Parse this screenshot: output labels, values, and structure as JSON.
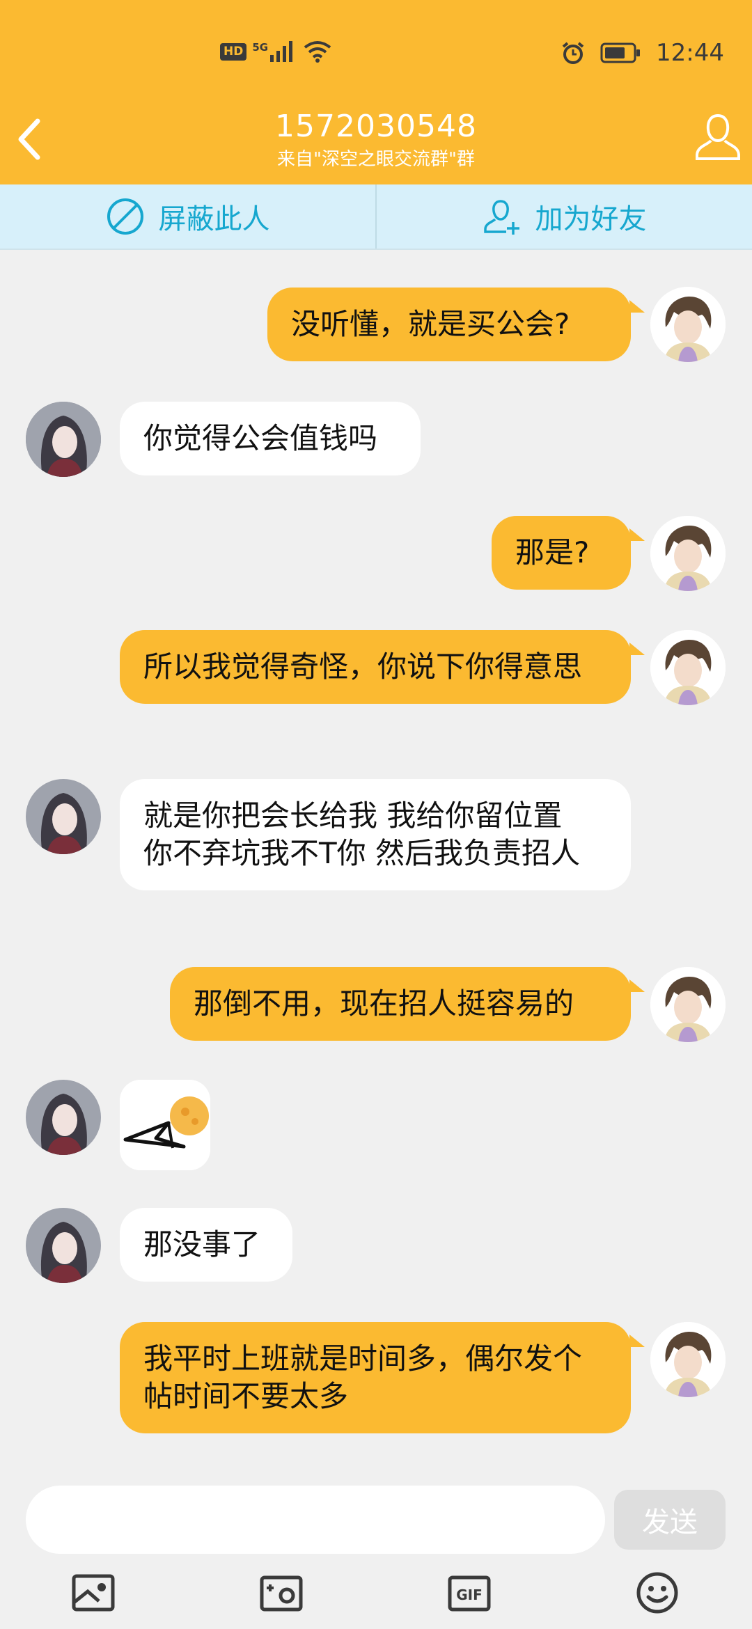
{
  "status_bar": {
    "network_badge": "HD",
    "network_type": "5G",
    "time": "12:44"
  },
  "header": {
    "title": "1572030548",
    "subtitle": "来自\"深空之眼交流群\"群"
  },
  "actions": {
    "block_label": "屏蔽此人",
    "add_friend_label": "加为好友"
  },
  "messages": [
    {
      "from": "me",
      "text": "没听懂，就是买公会?"
    },
    {
      "from": "other",
      "text": "你觉得公会值钱吗"
    },
    {
      "from": "me",
      "text": "那是?"
    },
    {
      "from": "me",
      "text": "所以我觉得奇怪，你说下你得意思"
    },
    {
      "from": "other",
      "text": "就是你把会长给我  我给你留位置\n你不弃坑我不T你   然后我负责招人"
    },
    {
      "from": "me",
      "text": "那倒不用，现在招人挺容易的"
    },
    {
      "from": "other",
      "type": "sticker",
      "sticker": "sticker-image"
    },
    {
      "from": "other",
      "text": "那没事了"
    },
    {
      "from": "me",
      "text": "我平时上班就是时间多，偶尔发个帖时间不要太多"
    }
  ],
  "input": {
    "value": "",
    "send_label": "发送"
  },
  "toolbar_icons": [
    "image-icon",
    "camera-icon",
    "gif-icon",
    "emoji-icon"
  ],
  "colors": {
    "header": "#fbba31",
    "action_bar": "#d7f0fa",
    "action_text": "#16a7cf",
    "my_bubble": "#fbba31",
    "other_bubble": "#ffffff",
    "background": "#f0f0f0"
  }
}
